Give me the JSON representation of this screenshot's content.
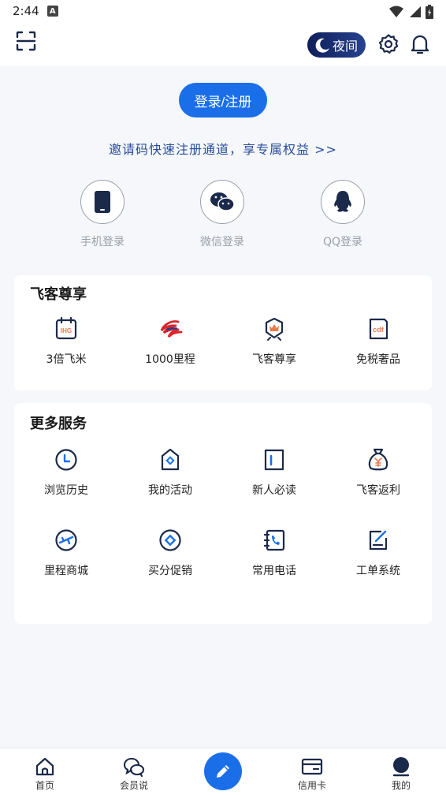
{
  "status_bar": {
    "time": "2:44",
    "badge": "A"
  },
  "header": {
    "night_label": "夜间"
  },
  "login": {
    "button_label": "登录/注册",
    "invite_text": "邀请码快速注册通道，享专属权益 >>",
    "options": [
      {
        "label": "手机登录",
        "icon": "phone-icon"
      },
      {
        "label": "微信登录",
        "icon": "wechat-icon"
      },
      {
        "label": "QQ登录",
        "icon": "qq-icon"
      }
    ]
  },
  "vip_section": {
    "title": "飞客尊享",
    "items": [
      {
        "label": "3倍飞米",
        "icon": "ihg-calendar-icon",
        "icon_text": "IHG"
      },
      {
        "label": "1000里程",
        "icon": "china-eastern-logo-icon"
      },
      {
        "label": "飞客尊享",
        "icon": "crown-badge-icon"
      },
      {
        "label": "免税奢品",
        "icon": "cdf-bag-icon",
        "icon_text": "cdf"
      }
    ]
  },
  "more_section": {
    "title": "更多服务",
    "items": [
      {
        "label": "浏览历史",
        "icon": "clock-icon"
      },
      {
        "label": "我的活动",
        "icon": "tag-icon"
      },
      {
        "label": "新人必读",
        "icon": "book-icon"
      },
      {
        "label": "飞客返利",
        "icon": "money-bag-icon"
      },
      {
        "label": "里程商城",
        "icon": "plane-circle-icon"
      },
      {
        "label": "买分促销",
        "icon": "diamond-circle-icon"
      },
      {
        "label": "常用电话",
        "icon": "phone-book-icon"
      },
      {
        "label": "工单系统",
        "icon": "edit-form-icon"
      }
    ]
  },
  "bottom_nav": {
    "items": [
      {
        "label": "首页",
        "icon": "home-icon"
      },
      {
        "label": "会员说",
        "icon": "chat-bubbles-icon"
      },
      {
        "label": "信用卡",
        "icon": "credit-card-icon"
      },
      {
        "label": "我的",
        "icon": "profile-icon"
      }
    ]
  },
  "colors": {
    "accent": "#1a6fe8",
    "link": "#2a4d9a",
    "icon_dark": "#1b2a4a",
    "brand_red": "#d9262c"
  }
}
